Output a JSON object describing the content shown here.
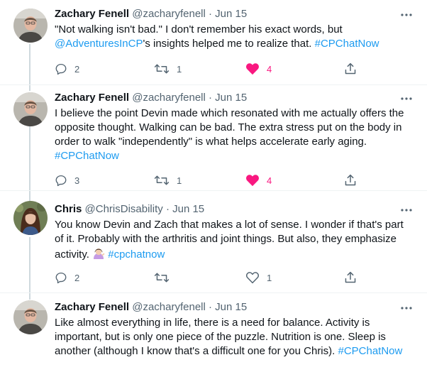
{
  "tweets": [
    {
      "name": "Zachary Fenell",
      "handle": "@zacharyfenell",
      "separator": "·",
      "date": "Jun 15",
      "text": {
        "l1": "\"Not walking isn't bad.\" I don't remember his exact words, but",
        "mention": "@AdventuresInCP",
        "l2": "'s insights helped me to realize that.",
        "hashtag": "#CPChatNow"
      },
      "replies": "2",
      "retweets": "1",
      "likes": "4",
      "liked": true
    },
    {
      "name": "Zachary Fenell",
      "handle": "@zacharyfenell",
      "separator": "·",
      "date": "Jun 15",
      "text": {
        "l1": "I believe the point Devin made which resonated with me actually offers the",
        "l2": "opposite thought. Walking can be bad. The extra stress put on the body in",
        "l3": "order to walk \"independently\" is what helps accelerate early aging.",
        "hashtag": "#CPChatNow"
      },
      "replies": "3",
      "retweets": "1",
      "likes": "4",
      "liked": true
    },
    {
      "name": "Chris",
      "handle": "@ChrisDisability",
      "separator": "·",
      "date": "Jun 15",
      "text": {
        "l1": "You know Devin and Zach that makes a lot of sense. I wonder if that's part",
        "l2": "of it. Probably with the arthritis and joint things. But also, they emphasize",
        "l3": "activity.",
        "hashtag": "#cpchatnow"
      },
      "replies": "2",
      "retweets": "",
      "likes": "1",
      "liked": false
    },
    {
      "name": "Zachary Fenell",
      "handle": "@zacharyfenell",
      "separator": "·",
      "date": "Jun 15",
      "text": {
        "l1": "Like almost everything in life, there is a need for balance. Activity is",
        "l2": "important, but is only one piece of the puzzle. Nutrition is one. Sleep is",
        "l3": "another (although I know that's a difficult one for you Chris).",
        "hashtag": "#CPChatNow"
      }
    }
  ],
  "icons": {
    "reply": "reply-icon",
    "retweet": "retweet-icon",
    "like": "heart-icon",
    "share": "share-icon",
    "more": "more-icon",
    "emoji": "woman-tipping-hand-emoji"
  },
  "colors": {
    "text": "#0f1419",
    "secondary": "#536471",
    "link": "#1d9bf0",
    "like": "#f91880",
    "thread_line": "#cfd9de"
  }
}
